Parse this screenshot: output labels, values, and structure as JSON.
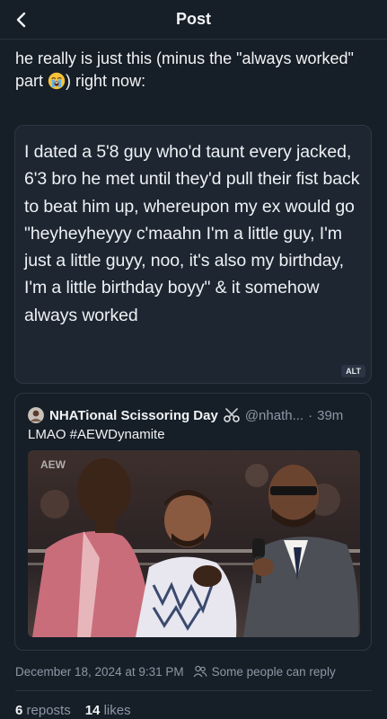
{
  "header": {
    "title": "Post"
  },
  "post": {
    "text_before": "he really is just this (minus the \"always worked\" part ",
    "emoji_name": "loudly-crying-face",
    "text_after": ") right now:"
  },
  "quoted_image": {
    "text": "I dated a 5'8 guy who'd taunt every jacked, 6'3 bro he met until they'd pull their fist back to beat him up, whereupon my ex would go \"heyheyheyyy c'maahn I'm a little guy, I'm just a little guyy, noo, it's also my birthday, I'm a little birthday boyy\" & it somehow always worked",
    "alt_label": "ALT"
  },
  "embed": {
    "author_name": "NHATional Scissoring Day",
    "author_emoji": "scissors",
    "handle": "@nhath...",
    "separator": "·",
    "time": "39m",
    "text": "LMAO #AEWDynamite",
    "media_watermark": "AEW"
  },
  "meta": {
    "timestamp": "December 18, 2024 at 9:31 PM",
    "reply_setting": "Some people can reply"
  },
  "stats": {
    "reposts_count": "6",
    "reposts_label": "reposts",
    "likes_count": "14",
    "likes_label": "likes"
  },
  "colors": {
    "background": "#161e27",
    "text": "#f1f3f5",
    "muted": "#8d98a6",
    "border": "#2a3441"
  }
}
